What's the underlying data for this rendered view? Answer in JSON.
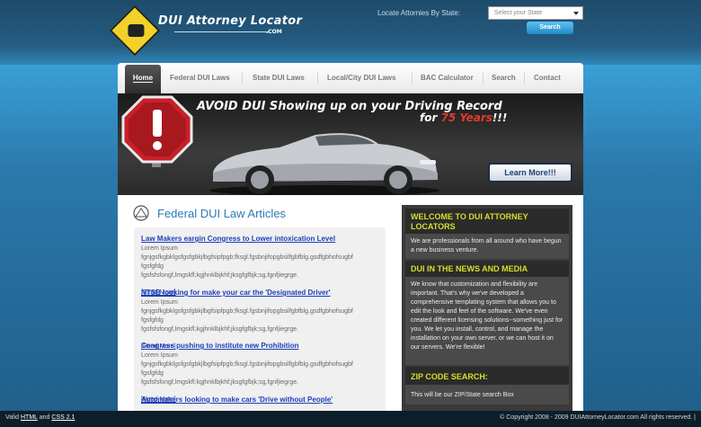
{
  "header": {
    "logo_title": "DUI Attorney Locator",
    "logo_suffix": ".COM",
    "locate_label": "Locate Attornies By State:",
    "state_select": {
      "selected": "Select your State"
    },
    "search_button": "Search"
  },
  "nav": {
    "items": [
      "Home",
      "Federal DUI Laws",
      "State DUI Laws",
      "Local/City DUI Laws",
      "BAC Calculator",
      "Search",
      "Contact"
    ],
    "active": "Home"
  },
  "banner": {
    "headline": "AVOID DUI Showing up on your Driving Record",
    "sub_prefix": "for ",
    "sub_highlight": "75 Years",
    "sub_suffix": "!!!",
    "learn_more": "Learn More!!!"
  },
  "articles": {
    "heading": "Federal DUI Law Articles",
    "items": [
      {
        "title": "Law Makers eargin Congress to Lower intoxication Level",
        "body": [
          "Lorem Ipsum",
          "fgnjgsfkgbklgsfgsfgbkjlbgfsipfpgb;fksgl.fgsbnjifopgbsilfgbfblg.gsdfgbhofsugbf",
          "fgsfgfdg",
          "fgsfsfsfongf,lmgskfl;kgjhnklbjkhf;jksgfgfbjk;sg,fgnfjiegrge."
        ],
        "read_more": "[Read More]"
      },
      {
        "title": "NTSB looking for make your car the 'Designated Driver'",
        "body": [
          "Lorem Ipsum",
          "fgnjgsfkgbklgsfgsfgbkjlbgfsipfpgb;fksgl.fgsbnjifopgbsilfgbfblg.gsdfgbhofsugbf",
          "fgsfgfdg",
          "fgsfsfsfongf,lmgskfl;kgjhnklbjkhf;jksgfgfbjk;sg,fgnfjiegrge."
        ],
        "read_more": "[Read More]"
      },
      {
        "title": "Congress pushing to institute new Prohibition",
        "body": [
          "Lorem Ipsum",
          "fgnjgsfkgbklgsfgsfgbkjlbgfsipfpgb;fksgl.fgsbnjifopgbsilfgbfblg.gsdfgbhofsugbf",
          "fgsfgfdg",
          "fgsfsfsfongf,lmgskfl;kgjhnklbjkhf;jksgfgfbjk;sg,fgnfjiegrge."
        ],
        "read_more": "[Read More]"
      },
      {
        "title": "Automakers looking to make cars 'Drive without People'",
        "body": [],
        "read_more": ""
      }
    ]
  },
  "sidebar": {
    "welcome_heading": "WELCOME TO DUI ATTORNEY LOCATORS",
    "welcome_body": "We are professionals from all around who have begun a new business venture.",
    "news_heading": "DUI IN THE NEWS AND MEDIA",
    "news_body": "We know that customization and flexibility are important. That's why we've developed a comprehensive templating system that allows you to edit the look and feel of the software. We've even created different licensing solutions--something just for you. We let you install, control, and manage the installation on your own server, or we can host it on our servers. We're flexible!",
    "zip_heading": "ZIP CODE SEARCH:",
    "zip_body": "This will be our ZIP/State search Box"
  },
  "footer": {
    "valid_prefix": "Valid ",
    "html_link": "HTML",
    "and_text": " and ",
    "css_link": "CSS 2.1",
    "copyright": "© Copyright 2008 - 2009 DUIAttorneyLocator.com All rights reserved. |"
  },
  "colors": {
    "accent_yellow": "#d5df2b",
    "link_blue": "#1d3fb7",
    "heading_blue": "#2b7bb3",
    "banner_red": "#e53a2a"
  }
}
